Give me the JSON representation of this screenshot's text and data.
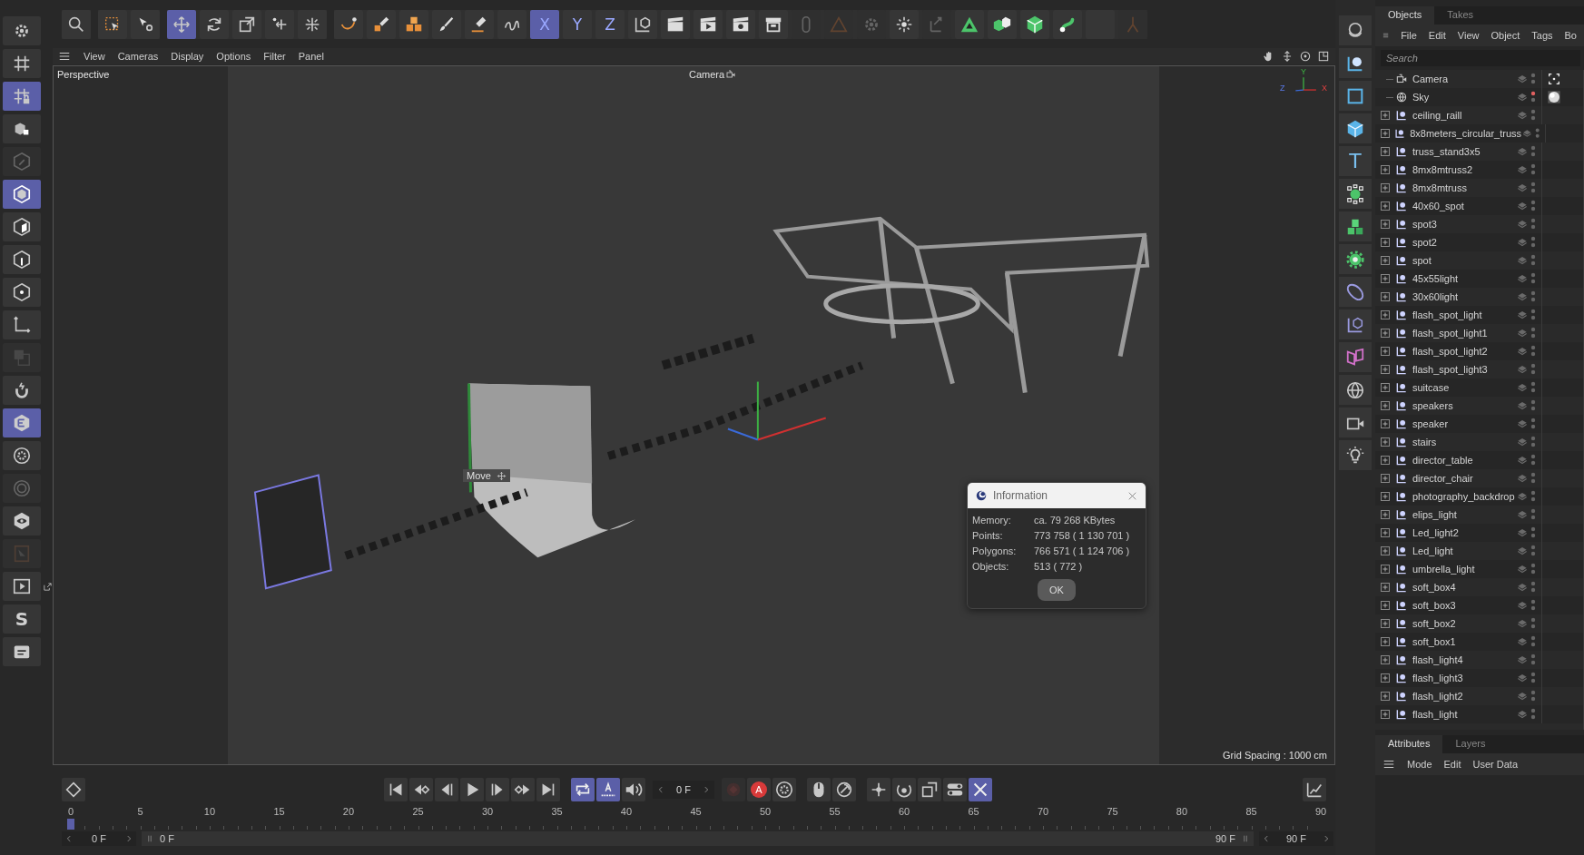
{
  "top_toolbar": [
    {
      "items": [
        {
          "kind": "search",
          "selected": false,
          "disabled": false
        }
      ]
    },
    {
      "items": [
        {
          "kind": "select-box",
          "selected": false,
          "disabled": false
        },
        {
          "kind": "pointer",
          "selected": false,
          "disabled": false
        }
      ]
    },
    {
      "items": [
        {
          "kind": "move",
          "selected": true,
          "disabled": false
        },
        {
          "kind": "rotate",
          "selected": false,
          "disabled": false
        },
        {
          "kind": "scale",
          "selected": false,
          "disabled": false
        },
        {
          "kind": "move-multi",
          "selected": false,
          "disabled": false
        },
        {
          "kind": "transform",
          "selected": false,
          "disabled": false
        }
      ]
    },
    {
      "items": [
        {
          "kind": "curve",
          "selected": false,
          "disabled": false
        },
        {
          "kind": "pen",
          "selected": false,
          "disabled": false
        },
        {
          "kind": "cubes",
          "selected": false,
          "disabled": false
        },
        {
          "kind": "brush",
          "selected": false,
          "disabled": false
        },
        {
          "kind": "pen-line",
          "selected": false,
          "disabled": false
        },
        {
          "kind": "sketch",
          "selected": false,
          "disabled": false
        },
        {
          "kind": "label",
          "label": "X",
          "selected": true,
          "disabled": false
        },
        {
          "kind": "label",
          "label": "Y",
          "selected": false,
          "disabled": false
        },
        {
          "kind": "label",
          "label": "Z",
          "selected": false,
          "disabled": false
        },
        {
          "kind": "cube-axes",
          "selected": false,
          "disabled": false
        },
        {
          "kind": "clapper",
          "selected": false,
          "disabled": false
        },
        {
          "kind": "clapper-play",
          "selected": false,
          "disabled": false
        },
        {
          "kind": "clapper-gear",
          "selected": false,
          "disabled": false
        },
        {
          "kind": "archive",
          "selected": false,
          "disabled": false
        },
        {
          "kind": "link",
          "selected": false,
          "disabled": true
        },
        {
          "kind": "triangle-outline",
          "selected": false,
          "disabled": true
        },
        {
          "kind": "gear",
          "selected": false,
          "disabled": true
        },
        {
          "kind": "sparkle",
          "selected": false,
          "disabled": false
        },
        {
          "kind": "axes-corner",
          "selected": false,
          "disabled": true
        },
        {
          "kind": "triangle",
          "selected": false,
          "disabled": false
        },
        {
          "kind": "cube-pair",
          "selected": false,
          "disabled": false
        },
        {
          "kind": "cube",
          "selected": false,
          "disabled": false
        },
        {
          "kind": "spline",
          "selected": false,
          "disabled": false
        },
        {
          "kind": "blank"
        },
        {
          "kind": "figure",
          "selected": false,
          "disabled": true
        }
      ]
    }
  ],
  "left_toolbar": [
    {
      "kind": "gear",
      "selected": false,
      "disabled": false
    },
    {
      "kind": "grid",
      "selected": false,
      "disabled": false
    },
    {
      "kind": "grid-lock",
      "selected": true,
      "disabled": false
    },
    {
      "kind": "cube-corners",
      "selected": false,
      "disabled": false
    },
    {
      "kind": "pencil-hex",
      "selected": false,
      "disabled": true
    },
    {
      "kind": "hex-cube",
      "selected": true,
      "disabled": false
    },
    {
      "kind": "hex-face",
      "selected": false,
      "disabled": false
    },
    {
      "kind": "hex-edge",
      "selected": false,
      "disabled": false
    },
    {
      "kind": "hex-point",
      "selected": false,
      "disabled": false
    },
    {
      "kind": "axes",
      "selected": false,
      "disabled": false
    },
    {
      "kind": "squares",
      "selected": false,
      "disabled": true
    },
    {
      "kind": "magnet",
      "selected": false,
      "disabled": false
    },
    {
      "kind": "hex-lines",
      "selected": true,
      "disabled": false
    },
    {
      "kind": "gear-circle",
      "selected": false,
      "disabled": false
    },
    {
      "kind": "target",
      "selected": false,
      "disabled": true
    },
    {
      "kind": "eye-hex",
      "selected": false,
      "disabled": false
    },
    {
      "kind": "frame",
      "selected": false,
      "disabled": true
    },
    {
      "kind": "play-frame",
      "selected": false,
      "disabled": false
    },
    {
      "kind": "label",
      "label": "S",
      "selected": false,
      "disabled": false
    },
    {
      "kind": "folder",
      "selected": false,
      "disabled": false
    }
  ],
  "viewport": {
    "menu": [
      "View",
      "Cameras",
      "Display",
      "Options",
      "Filter",
      "Panel"
    ],
    "view_name": "Perspective",
    "camera": "Camera",
    "axes": [
      "Y",
      "Z",
      "X"
    ],
    "tool_hint": "Move",
    "grid_spacing": "Grid Spacing : 1000 cm"
  },
  "info_dialog": {
    "title": "Information",
    "rows": [
      {
        "label": "Memory:",
        "value": "ca. 79 268 KBytes"
      },
      {
        "label": "Points:",
        "value": "773 758 ( 1 130 701 )"
      },
      {
        "label": "Polygons:",
        "value": "766 571 ( 1 124 706 )"
      },
      {
        "label": "Objects:",
        "value": "513 ( 772 )"
      }
    ],
    "button": "OK"
  },
  "timeline": {
    "controls": [
      {
        "kind": "skip-start",
        "selected": false,
        "disabled": false
      },
      {
        "kind": "prev-key",
        "selected": false,
        "disabled": false
      },
      {
        "kind": "prev-frame",
        "selected": false,
        "disabled": false
      },
      {
        "kind": "play",
        "selected": false,
        "disabled": false
      },
      {
        "kind": "next-frame",
        "selected": false,
        "disabled": false
      },
      {
        "kind": "next-key",
        "selected": false,
        "disabled": false
      },
      {
        "kind": "skip-end",
        "selected": false,
        "disabled": false
      },
      {
        "kind": "gap"
      },
      {
        "kind": "loop",
        "selected": true,
        "disabled": false
      },
      {
        "kind": "track",
        "selected": true,
        "disabled": false
      },
      {
        "kind": "speaker",
        "selected": false,
        "disabled": false
      },
      {
        "kind": "frame-field",
        "value": "0 F"
      },
      {
        "kind": "record",
        "selected": false,
        "disabled": true
      },
      {
        "kind": "autokey",
        "label": "A",
        "selected": false,
        "disabled": false
      },
      {
        "kind": "gear-circle",
        "selected": false,
        "disabled": false
      },
      {
        "kind": "gap"
      },
      {
        "kind": "mouse",
        "selected": false,
        "disabled": false
      },
      {
        "kind": "dial",
        "selected": false,
        "disabled": false
      },
      {
        "kind": "gap"
      },
      {
        "kind": "move-key",
        "selected": false,
        "disabled": false
      },
      {
        "kind": "rotate-key",
        "selected": false,
        "disabled": false
      },
      {
        "kind": "scale-key",
        "selected": false,
        "disabled": false
      },
      {
        "kind": "toggle",
        "selected": false,
        "disabled": false
      },
      {
        "kind": "tool-cross",
        "selected": true,
        "disabled": false
      }
    ],
    "ticks": [
      "0",
      "5",
      "10",
      "15",
      "20",
      "25",
      "30",
      "35",
      "40",
      "45",
      "50",
      "55",
      "60",
      "65",
      "70",
      "75",
      "80",
      "85",
      "90"
    ],
    "start_field": "0 F",
    "range_start": "0 F",
    "range_end": "90 F",
    "end_field": "90 F"
  },
  "objects_panel": {
    "tabs": [
      {
        "label": "Objects",
        "selected": true
      },
      {
        "label": "Takes",
        "selected": false
      }
    ],
    "menu": [
      "File",
      "Edit",
      "View",
      "Object",
      "Tags",
      "Bo"
    ],
    "search": {
      "placeholder": "Search"
    },
    "rows": [
      {
        "name": "Camera",
        "kind": "camera",
        "tag": {
          "kind": "target"
        }
      },
      {
        "name": "Sky",
        "kind": "sky",
        "color": "#e06060",
        "tag": {
          "kind": "material"
        }
      },
      {
        "name": "ceiling_raill",
        "kind": "null",
        "expanded": false
      },
      {
        "name": "8x8meters_circular_truss",
        "kind": "null",
        "expanded": false
      },
      {
        "name": "truss_stand3x5",
        "kind": "null",
        "expanded": false
      },
      {
        "name": "8mx8mtruss2",
        "kind": "null",
        "expanded": false
      },
      {
        "name": "8mx8mtruss",
        "kind": "null",
        "expanded": false
      },
      {
        "name": "40x60_spot",
        "kind": "null",
        "expanded": false
      },
      {
        "name": "spot3",
        "kind": "null",
        "expanded": false
      },
      {
        "name": "spot2",
        "kind": "null",
        "expanded": false
      },
      {
        "name": "spot",
        "kind": "null",
        "expanded": false
      },
      {
        "name": "45x55light",
        "kind": "null",
        "expanded": false
      },
      {
        "name": "30x60light",
        "kind": "null",
        "expanded": false
      },
      {
        "name": "flash_spot_light",
        "kind": "null",
        "expanded": false
      },
      {
        "name": "flash_spot_light1",
        "kind": "null",
        "expanded": false
      },
      {
        "name": "flash_spot_light2",
        "kind": "null",
        "expanded": false
      },
      {
        "name": "flash_spot_light3",
        "kind": "null",
        "expanded": false
      },
      {
        "name": "suitcase",
        "kind": "null",
        "expanded": false
      },
      {
        "name": "speakers",
        "kind": "null",
        "expanded": false
      },
      {
        "name": "speaker",
        "kind": "null",
        "expanded": false
      },
      {
        "name": "stairs",
        "kind": "null",
        "expanded": false
      },
      {
        "name": "director_table",
        "kind": "null",
        "expanded": false
      },
      {
        "name": "director_chair",
        "kind": "null",
        "expanded": false
      },
      {
        "name": "photography_backdrop",
        "kind": "null",
        "expanded": false
      },
      {
        "name": "elips_light",
        "kind": "null",
        "expanded": false
      },
      {
        "name": "Led_light2",
        "kind": "null",
        "expanded": false
      },
      {
        "name": "Led_light",
        "kind": "null",
        "expanded": false
      },
      {
        "name": "umbrella_light",
        "kind": "null",
        "expanded": false
      },
      {
        "name": "soft_box4",
        "kind": "null",
        "expanded": false
      },
      {
        "name": "soft_box3",
        "kind": "null",
        "expanded": false
      },
      {
        "name": "soft_box2",
        "kind": "null",
        "expanded": false
      },
      {
        "name": "soft_box1",
        "kind": "null",
        "expanded": false
      },
      {
        "name": "flash_light4",
        "kind": "null",
        "expanded": false
      },
      {
        "name": "flash_light3",
        "kind": "null",
        "expanded": false
      },
      {
        "name": "flash_light2",
        "kind": "null",
        "expanded": false
      },
      {
        "name": "flash_light",
        "kind": "null",
        "expanded": false
      }
    ]
  },
  "attributes_panel": {
    "tabs": [
      {
        "label": "Attributes",
        "selected": true
      },
      {
        "label": "Layers",
        "selected": false
      }
    ],
    "menu": [
      "Mode",
      "Edit",
      "User Data"
    ]
  },
  "palette": [
    {
      "kind": "sphere"
    },
    {
      "kind": "spline-point"
    },
    {
      "kind": "square"
    },
    {
      "kind": "cube-blue"
    },
    {
      "kind": "label",
      "label": "T"
    },
    {
      "kind": "dots-circle"
    },
    {
      "kind": "cubes-green"
    },
    {
      "kind": "gear-green"
    },
    {
      "kind": "deformer"
    },
    {
      "kind": "axes-cube"
    },
    {
      "kind": "pink-shape"
    },
    {
      "kind": "globe"
    },
    {
      "kind": "camera"
    },
    {
      "kind": "bulb"
    }
  ]
}
